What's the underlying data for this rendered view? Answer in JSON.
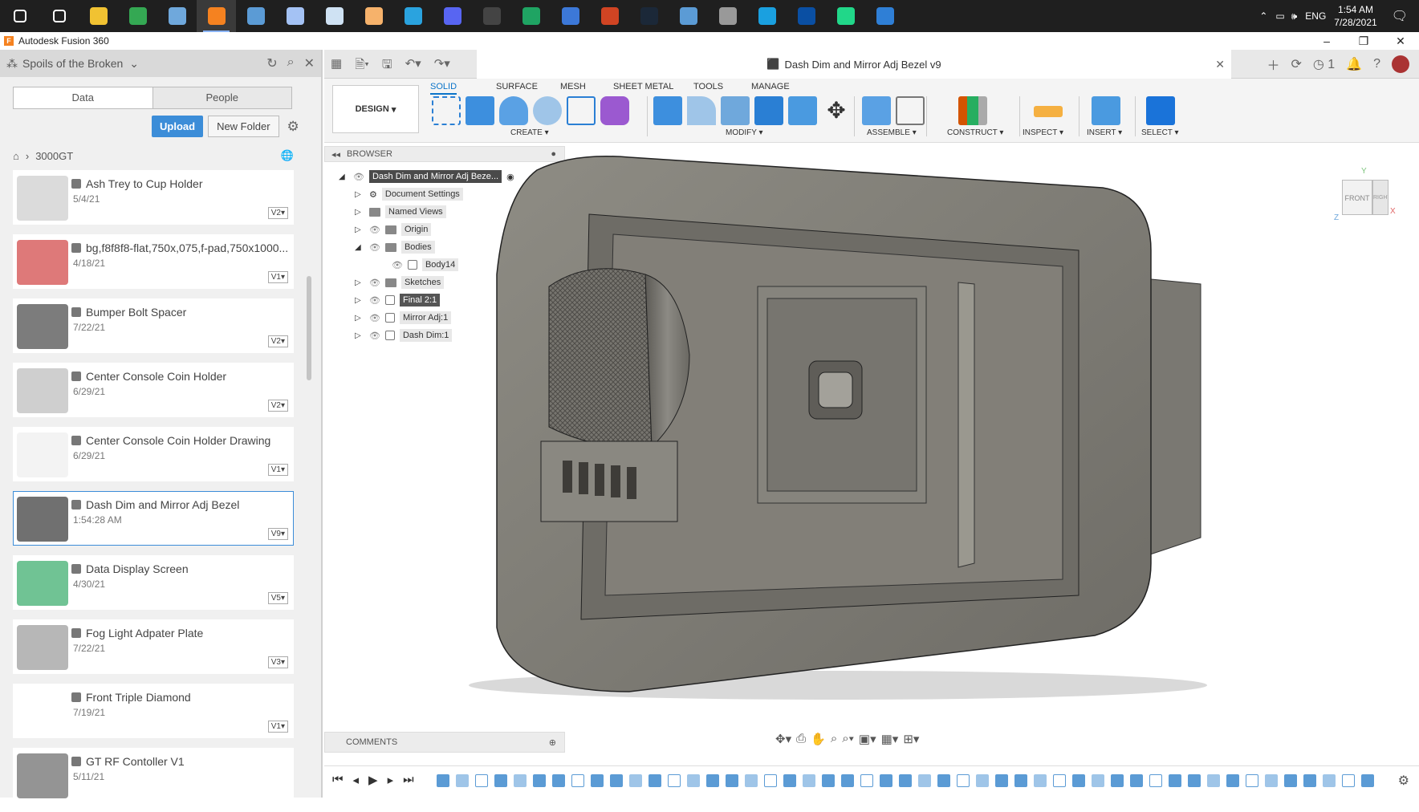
{
  "taskbar": {
    "apps": [
      {
        "name": "start",
        "color": "#ffffff"
      },
      {
        "name": "search",
        "color": "#ffffff"
      },
      {
        "name": "file-explorer",
        "color": "#f1c232"
      },
      {
        "name": "chrome",
        "color": "#34a853"
      },
      {
        "name": "app-blue",
        "color": "#6fa8dc"
      },
      {
        "name": "fusion-360",
        "color": "#f58220"
      },
      {
        "name": "calculator",
        "color": "#5b9bd5"
      },
      {
        "name": "app-swirl",
        "color": "#a4c2f4"
      },
      {
        "name": "app-image",
        "color": "#cfe2f3"
      },
      {
        "name": "app-puzzle",
        "color": "#f6b26b"
      },
      {
        "name": "telegram",
        "color": "#2aa3df"
      },
      {
        "name": "discord",
        "color": "#5865f2"
      },
      {
        "name": "app-dark",
        "color": "#444444"
      },
      {
        "name": "app-green-circle",
        "color": "#1fa463"
      },
      {
        "name": "app-photo",
        "color": "#3c78d8"
      },
      {
        "name": "powerpoint",
        "color": "#d04423"
      },
      {
        "name": "steam",
        "color": "#1b2838"
      },
      {
        "name": "app-cloud",
        "color": "#5b9bd5"
      },
      {
        "name": "app-grey",
        "color": "#999999"
      },
      {
        "name": "app-c",
        "color": "#1aa0e0"
      },
      {
        "name": "app-figure",
        "color": "#0a4fa3"
      },
      {
        "name": "pycharm",
        "color": "#21d789"
      },
      {
        "name": "app-window",
        "color": "#2f7fd6"
      }
    ],
    "tray": {
      "lang": "ENG",
      "time": "1:54 AM",
      "date": "7/28/2021"
    }
  },
  "window": {
    "title": "Autodesk Fusion 360"
  },
  "left": {
    "project": "Spoils of the Broken",
    "tabs": [
      "Data",
      "People"
    ],
    "upload": "Upload",
    "new_folder": "New Folder",
    "breadcrumb": "3000GT",
    "files": [
      {
        "name": "Ash Trey to Cup Holder",
        "date": "5/4/21",
        "ver": "V2"
      },
      {
        "name": "bg,f8f8f8-flat,750x,075,f-pad,750x1000...",
        "date": "4/18/21",
        "ver": "V1"
      },
      {
        "name": "Bumper Bolt Spacer",
        "date": "7/22/21",
        "ver": "V2"
      },
      {
        "name": "Center Console Coin Holder",
        "date": "6/29/21",
        "ver": "V2"
      },
      {
        "name": "Center Console Coin Holder Drawing",
        "date": "6/29/21",
        "ver": "V1"
      },
      {
        "name": "Dash Dim and Mirror Adj Bezel",
        "date": "1:54:28 AM",
        "ver": "V9"
      },
      {
        "name": "Data Display Screen",
        "date": "4/30/21",
        "ver": "V5"
      },
      {
        "name": "Fog Light Adpater Plate",
        "date": "7/22/21",
        "ver": "V3"
      },
      {
        "name": "Front Triple Diamond",
        "date": "7/19/21",
        "ver": "V1"
      },
      {
        "name": "GT RF Contoller V1",
        "date": "5/11/21",
        "ver": ""
      }
    ]
  },
  "doc": {
    "tab_title": "Dash Dim and Mirror Adj Bezel v9"
  },
  "toolbar": {
    "workspace": "DESIGN",
    "tabs": [
      "SOLID",
      "SURFACE",
      "MESH",
      "SHEET METAL",
      "TOOLS",
      "MANAGE"
    ],
    "groups": [
      "CREATE",
      "MODIFY",
      "ASSEMBLE",
      "CONSTRUCT",
      "INSPECT",
      "INSERT",
      "SELECT"
    ]
  },
  "browser": {
    "title": "BROWSER",
    "root": "Dash Dim and Mirror Adj Beze...",
    "items": [
      "Document Settings",
      "Named Views",
      "Origin",
      "Bodies",
      "Body14",
      "Sketches",
      "Final 2:1",
      "Mirror Adj:1",
      "Dash Dim:1"
    ]
  },
  "viewcube": {
    "front": "FRONT",
    "right": "RIGHT"
  },
  "comments": "COMMENTS"
}
